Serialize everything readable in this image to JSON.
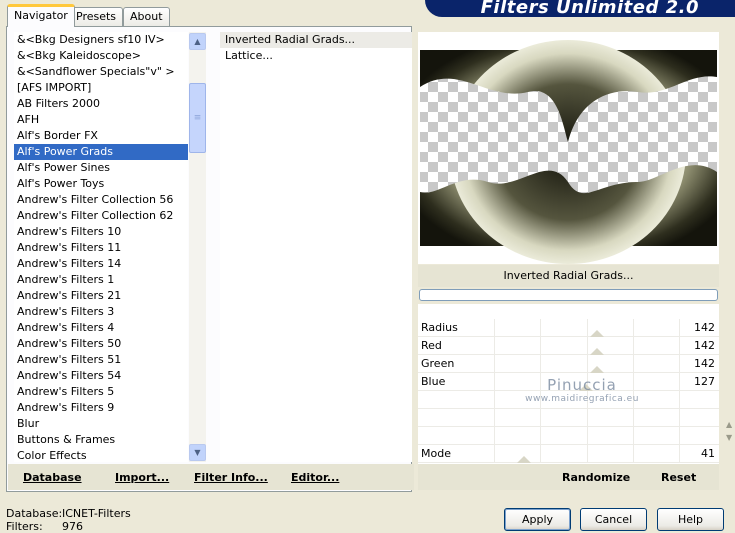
{
  "tabs": [
    {
      "label": "Navigator",
      "active": true
    },
    {
      "label": "Presets",
      "active": false
    },
    {
      "label": "About",
      "active": false
    }
  ],
  "banner_title": "Filters Unlimited 2.0",
  "categories": [
    "&<Bkg Designers sf10 IV>",
    "&<Bkg Kaleidoscope>",
    "&<Sandflower Specials\"v\" >",
    "[AFS IMPORT]",
    "AB Filters 2000",
    "AFH",
    "Alf's Border FX",
    "Alf's Power Grads",
    "Alf's Power Sines",
    "Alf's Power Toys",
    "Andrew's Filter Collection 56",
    "Andrew's Filter Collection 62",
    "Andrew's Filters 10",
    "Andrew's Filters 11",
    "Andrew's Filters 14",
    "Andrew's Filters 1",
    "Andrew's Filters 21",
    "Andrew's Filters 3",
    "Andrew's Filters 4",
    "Andrew's Filters 50",
    "Andrew's Filters 51",
    "Andrew's Filters 54",
    "Andrew's Filters 5",
    "Andrew's Filters 9",
    "Blur",
    "Buttons & Frames",
    "Color Effects"
  ],
  "selected_category_index": 7,
  "filters": [
    "Inverted Radial Grads...",
    "Lattice..."
  ],
  "selected_filter_index": 0,
  "left_links": {
    "database": "Database",
    "import": "Import...",
    "filter_info": "Filter Info...",
    "editor": "Editor..."
  },
  "filter_title": "Inverted Radial Grads...",
  "params": [
    {
      "name": "Radius",
      "value": "142"
    },
    {
      "name": "Red",
      "value": "142"
    },
    {
      "name": "Green",
      "value": "142"
    },
    {
      "name": "Blue",
      "value": "127"
    },
    {
      "name": "",
      "value": ""
    },
    {
      "name": "",
      "value": ""
    },
    {
      "name": "",
      "value": ""
    },
    {
      "name": "Mode",
      "value": "41"
    }
  ],
  "right_links": {
    "randomize": "Randomize",
    "reset": "Reset"
  },
  "watermark": {
    "line1": "Pinuccia",
    "line2": "www.maidiregrafica.eu"
  },
  "status": {
    "database_label": "Database:",
    "database_value": "ICNET-Filters",
    "filters_label": "Filters:",
    "filters_value": "976"
  },
  "buttons": {
    "apply": "Apply",
    "cancel": "Cancel",
    "help": "Help"
  },
  "colors": {
    "selection": "#316ac5",
    "banner": "#0a246a",
    "dialog_bg": "#ece9d8"
  }
}
